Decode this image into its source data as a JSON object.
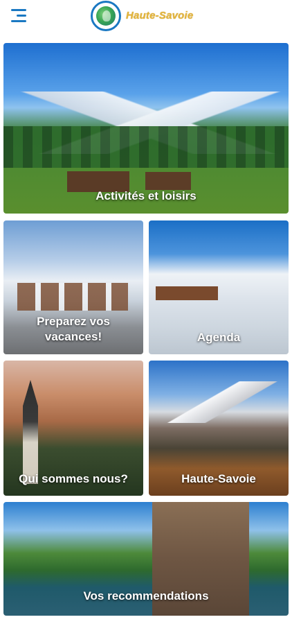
{
  "header": {
    "brand": "Haute-Savoie",
    "menu_icon": "hamburger-menu-icon",
    "logo_icon": "globe-logo-icon"
  },
  "tiles": [
    {
      "label": "Activités et loisirs"
    },
    {
      "label": "Preparez vos vacances!"
    },
    {
      "label": "Agenda"
    },
    {
      "label": "Qui sommes nous?"
    },
    {
      "label": "Haute-Savoie"
    },
    {
      "label": "Vos recommendations"
    }
  ],
  "colors": {
    "accent": "#1a78c2",
    "brand_text": "#e3b43a"
  }
}
